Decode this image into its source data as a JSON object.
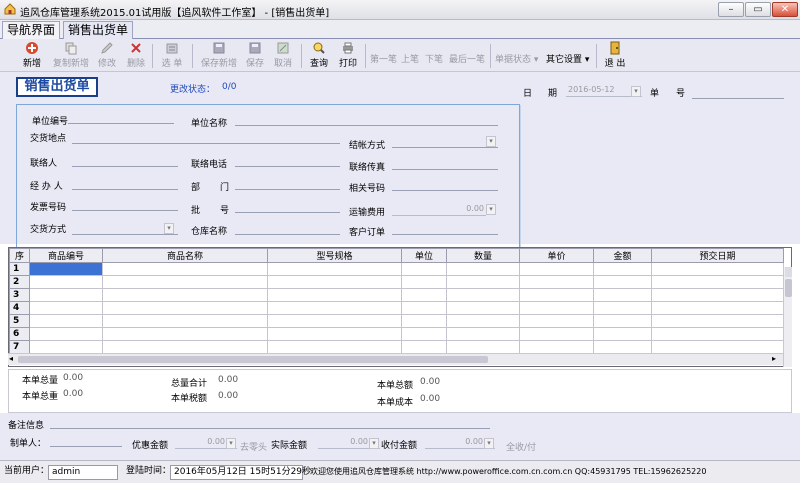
{
  "window": {
    "title": "追风仓库管理系统2015.01试用版【追风软件工作室】 - [销售出货单]",
    "controls": [
      "–",
      "▭",
      "✕"
    ]
  },
  "tabs": [
    {
      "label": "导航界面"
    },
    {
      "label": "销售出货单"
    }
  ],
  "toolbar": {
    "new": "新增",
    "copy_new": "复制新增",
    "edit": "修改",
    "delete": "删除",
    "select": "选 单",
    "save_new": "保存新增",
    "save": "保存",
    "cancel": "取消",
    "query": "查询",
    "print": "打印",
    "first": "第一笔",
    "prev": "上笔",
    "next": "下笔",
    "last": "最后一笔",
    "doc_status": "单据状态",
    "other_settings": "其它设置",
    "exit": "退 出"
  },
  "header": {
    "doc_title": "销售出货单",
    "change_status_label": "更改状态：",
    "change_status_value": "0/0",
    "date_label_1": "日",
    "date_label_2": "期",
    "date_value": "2016-05-12",
    "doc_no_label_1": "单",
    "doc_no_label_2": "号"
  },
  "form": {
    "unit_code": "单位编号",
    "unit_name": "单位名称",
    "delivery_address": "交货地点",
    "settlement": "结帐方式",
    "contact": "联络人",
    "contact_phone": "联络电话",
    "contact_fax": "联络传真",
    "handler": "经 办 人",
    "dept_1": "部",
    "dept_2": "门",
    "related_no": "相关号码",
    "invoice_no": "发票号码",
    "batch_1": "批",
    "batch_2": "号",
    "freight": "运输费用",
    "freight_value": "0.00",
    "delivery_method": "交货方式",
    "warehouse": "仓库名称",
    "customer_order": "客户订单"
  },
  "grid": {
    "columns": [
      "序",
      "商品编号",
      "商品名称",
      "型号规格",
      "单位",
      "数量",
      "单价",
      "金额",
      "预交日期"
    ],
    "rows": [
      "1",
      "2",
      "3",
      "4",
      "5",
      "6",
      "7"
    ]
  },
  "totals": {
    "total_qty_label": "本单总量",
    "total_qty": "0.00",
    "total_sum_label": "总量合计",
    "total_sum": "0.00",
    "total_amount_label": "本单总额",
    "total_amount": "0.00",
    "total_weight_label": "本单总重",
    "total_weight": "0.00",
    "total_tax_label": "本单税额",
    "total_tax": "0.00",
    "total_cost_label": "本单成本",
    "total_cost": "0.00"
  },
  "footer": {
    "remark": "备注信息",
    "maker": "制单人：",
    "discount_label": "优惠金额",
    "discount_value": "0.00",
    "round_off": "去零头",
    "actual_label": "实际金额",
    "actual_value": "0.00",
    "received_label": "收付金额",
    "received_value": "0.00",
    "paid_all": "全收/付"
  },
  "statusbar": {
    "user_label": "当前用户：",
    "user": "admin",
    "login_label": "登陆时间：",
    "login_time": "2016年05月12日  15时51分29秒",
    "welcome": "欢迎您使用追风仓库管理系统 http://www.poweroffice.com.cn.com.cn QQ:45931795 TEL:15962625220"
  },
  "colors": {
    "accent": "#2049b9",
    "form_bg": "#e9e9f6",
    "selection": "#3b72d3"
  }
}
